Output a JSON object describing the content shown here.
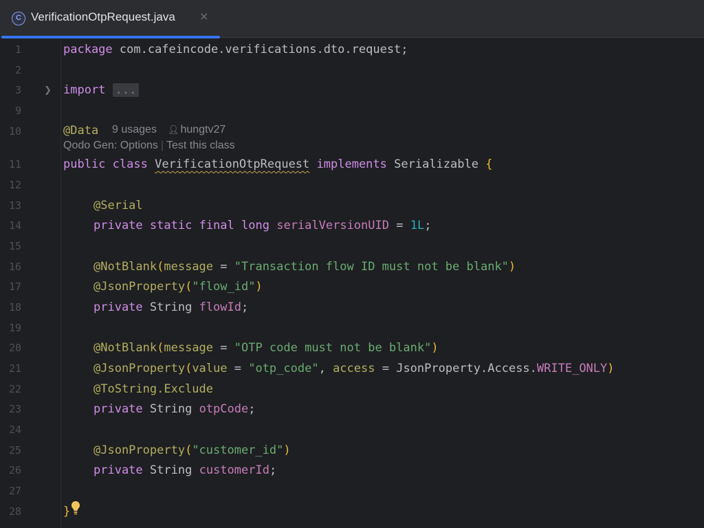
{
  "tab": {
    "icon": "class-icon",
    "icon_letter": "C",
    "title": "VerificationOtpRequest.java",
    "close": "×"
  },
  "gutter": {
    "line_numbers": [
      "1",
      "2",
      "3",
      "9",
      "10",
      "11",
      "12",
      "13",
      "14",
      "15",
      "16",
      "17",
      "18",
      "19",
      "20",
      "21",
      "22",
      "23",
      "24",
      "25",
      "26",
      "27",
      "28"
    ]
  },
  "code": {
    "l1": {
      "kw": "package",
      "rest": " com.cafeincode.verifications.dto.request;"
    },
    "l3": {
      "kw": "import",
      "dots": "..."
    },
    "l10": {
      "annotation": "@Data"
    },
    "l10_hint": {
      "usages": "9 usages",
      "author": "hungtv27"
    },
    "codelens": {
      "options": "Qodo Gen: Options",
      "test": "Test this class"
    },
    "l11": {
      "kw1": "public",
      "kw2": "class",
      "name": "VerificationOtpRequest",
      "kw3": "implements",
      "iface": "Serializable",
      "brace": "{"
    },
    "l13": {
      "annotation": "@Serial"
    },
    "l14": {
      "kw1": "private",
      "kw2": "static",
      "kw3": "final",
      "kw4": "long",
      "field": "serialVersionUID",
      "eq": " = ",
      "num": "1L",
      "end": ";"
    },
    "l16": {
      "annotation": "@NotBlank",
      "open": "(",
      "param": "message",
      "eq": " = ",
      "str": "\"Transaction flow ID must not be blank\"",
      "close": ")"
    },
    "l17": {
      "annotation": "@JsonProperty",
      "open": "(",
      "str": "\"flow_id\"",
      "close": ")"
    },
    "l18": {
      "kw": "private",
      "type": "String",
      "field": "flowId",
      "end": ";"
    },
    "l20": {
      "annotation": "@NotBlank",
      "open": "(",
      "param": "message",
      "eq": " = ",
      "str": "\"OTP code must not be blank\"",
      "close": ")"
    },
    "l21": {
      "annotation": "@JsonProperty",
      "open": "(",
      "param1": "value",
      "eq": " = ",
      "str": "\"otp_code\"",
      "comma": ", ",
      "param2": "access",
      "ref": "JsonProperty.Access.",
      "const": "WRITE_ONLY",
      "close": ")"
    },
    "l22": {
      "annotation": "@ToString.Exclude"
    },
    "l23": {
      "kw": "private",
      "type": "String",
      "field": "otpCode",
      "end": ";"
    },
    "l25": {
      "annotation": "@JsonProperty",
      "open": "(",
      "str": "\"customer_id\"",
      "close": ")"
    },
    "l26": {
      "kw": "private",
      "type": "String",
      "field": "customerId",
      "end": ";"
    },
    "l28": {
      "brace": "}"
    }
  },
  "icons": {
    "fold": "chevron-right-icon",
    "bulb": "lightbulb-icon",
    "user": "user-icon"
  },
  "colors": {
    "accent": "#3574f0",
    "keyword": "#cf8ee8",
    "annotation": "#b3ae60",
    "string": "#6aab73",
    "field": "#c77dbb",
    "number": "#2aacb8",
    "background": "#1e1f22"
  }
}
